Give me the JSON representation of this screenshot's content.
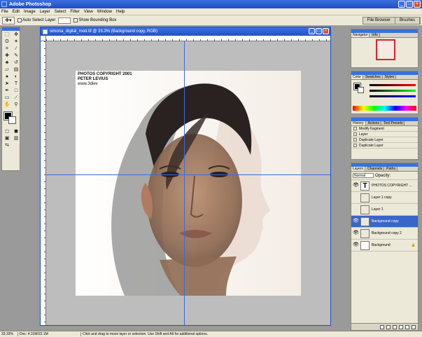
{
  "app": {
    "title": "Adobe Photoshop"
  },
  "menu": [
    "File",
    "Edit",
    "Image",
    "Layer",
    "Select",
    "Filter",
    "View",
    "Window",
    "Help"
  ],
  "options": {
    "auto_select": "Auto Select Layer",
    "show_bounding": "Show Bounding Box"
  },
  "palette_well": [
    "File Browser",
    "Brushes"
  ],
  "document": {
    "title": "simona_digital_mod.tif @ 33.3% (Background copy, RGB)",
    "copyright_line1": "PHOTOS COPYRIGHT 2001",
    "copyright_line2": "PETER LEVIUS",
    "copyright_line3": "www.3dlev"
  },
  "panels": {
    "navigator_tabs": [
      "Navigator",
      "Info"
    ],
    "color_tabs": [
      "Color",
      "Swatches",
      "Styles"
    ],
    "history_tabs": [
      "History",
      "Actions",
      "Tool Presets"
    ],
    "history_items": [
      "Modify fragment",
      "Layer",
      "Duplicate Layer",
      "Duplicate Layer"
    ],
    "layers_tabs": [
      "Layers",
      "Channels",
      "Paths"
    ],
    "blend_mode": "Normal",
    "opacity_label": "Opacity:",
    "layers": [
      {
        "name": "PHOTOS COPYRIGHT ...",
        "type": "text",
        "visible": true,
        "active": false
      },
      {
        "name": "Layer 1 copy",
        "type": "image",
        "visible": false,
        "active": false
      },
      {
        "name": "Layer 1",
        "type": "image",
        "visible": false,
        "active": false
      },
      {
        "name": "Background copy",
        "type": "image",
        "visible": true,
        "active": true
      },
      {
        "name": "Background copy 2",
        "type": "image",
        "visible": true,
        "active": false
      },
      {
        "name": "Background",
        "type": "image",
        "visible": true,
        "active": false
      }
    ]
  },
  "status": {
    "zoom": "33.33%",
    "doc": "Doc: 4.31M/22.1M",
    "message": "Click and drag to move layer or selection. Use Shift and Alt for additional options."
  },
  "colors": {
    "title_blue": "#2452c8",
    "guide": "#3b6bdc",
    "panel_bg": "#ece9d8",
    "active_layer": "#3a66c9"
  }
}
